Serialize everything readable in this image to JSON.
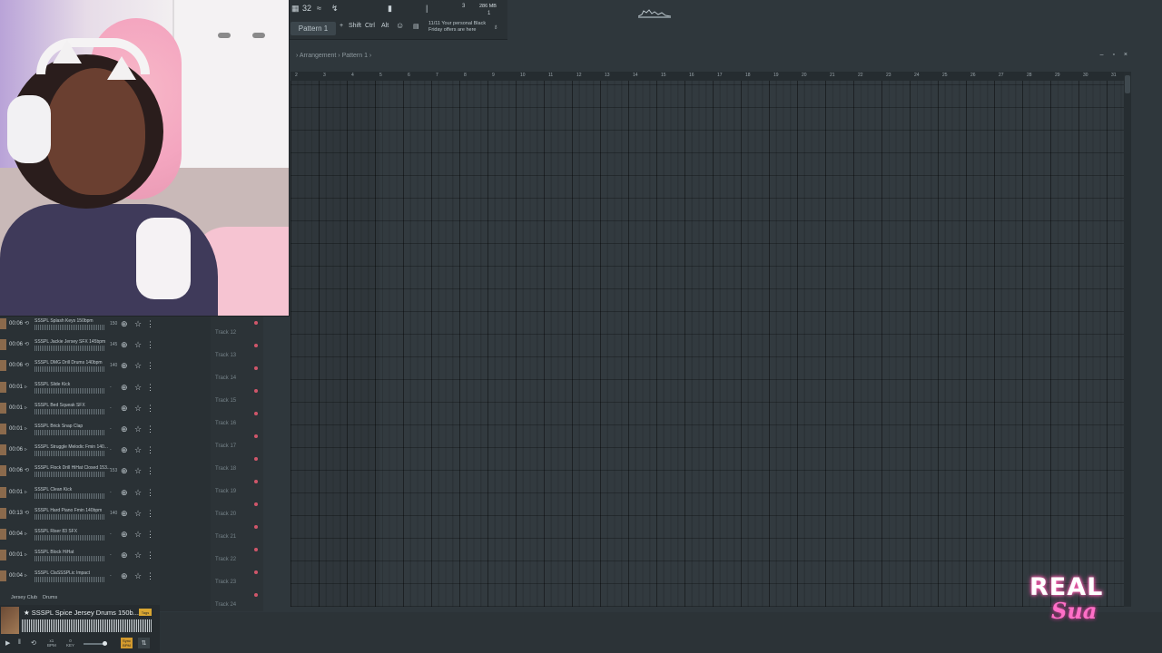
{
  "toolbar": {
    "tb_items": [
      "32",
      "≈",
      "↯"
    ],
    "pattern_label": "Pattern 1",
    "keys": [
      "Shift",
      "Ctrl",
      "Alt"
    ],
    "news_line1": "11/11  Your personal Black",
    "news_line2": "Friday offers are here",
    "mem_label": "286 MB",
    "counter1": "3",
    "counter2": "1"
  },
  "playlist": {
    "breadcrumb": "› Arrangement › Pattern 1 ›",
    "window_buttons": "– ▫ ×",
    "ruler": [
      "2",
      "3",
      "4",
      "5",
      "6",
      "7",
      "8",
      "9",
      "10",
      "11",
      "12",
      "13",
      "14",
      "15",
      "16",
      "17",
      "18",
      "19",
      "20",
      "21",
      "22",
      "23",
      "24",
      "25",
      "26",
      "27",
      "28",
      "29",
      "30",
      "31"
    ]
  },
  "tracks": [
    "Track 12",
    "Track 13",
    "Track 14",
    "Track 15",
    "Track 16",
    "Track 17",
    "Track 18",
    "Track 19",
    "Track 20",
    "Track 21",
    "Track 22",
    "Track 23",
    "Track 24"
  ],
  "browser": {
    "rows": [
      {
        "time": "00:06",
        "mode": "⟲",
        "name": "SSSPL Splash Keys 150bpm",
        "bpm": "150"
      },
      {
        "time": "00:06",
        "mode": "⟲",
        "name": "SSSPL Jackie Jersey SFX 145bpm",
        "bpm": "145"
      },
      {
        "time": "00:06",
        "mode": "⟲",
        "name": "SSSPL DMG Drill Drums 140bpm",
        "bpm": "140"
      },
      {
        "time": "00:01",
        "mode": "▹",
        "name": "SSSPL Slide Kick",
        "bpm": "-"
      },
      {
        "time": "00:01",
        "mode": "▹",
        "name": "SSSPL Bed Squeak SFX",
        "bpm": "-"
      },
      {
        "time": "00:01",
        "mode": "▹",
        "name": "SSSPL Brick Snap Clap",
        "bpm": "-"
      },
      {
        "time": "00:06",
        "mode": "▹",
        "name": "SSSPL Struggle Melodic Fmin 140...",
        "bpm": "-"
      },
      {
        "time": "00:06",
        "mode": "⟲",
        "name": "SSSPL Flock Drill HiHat Closed 153...",
        "bpm": "153"
      },
      {
        "time": "00:01",
        "mode": "▹",
        "name": "SSSPL Clean Kick",
        "bpm": "-"
      },
      {
        "time": "00:13",
        "mode": "⟲",
        "name": "SSSPL Hard Piano Fmin 140bpm",
        "bpm": "140"
      },
      {
        "time": "00:04",
        "mode": "▹",
        "name": "SSSPL Riser 83 SFX",
        "bpm": "-"
      },
      {
        "time": "00:01",
        "mode": "▹",
        "name": "SSSPL Block HiHat",
        "bpm": "-"
      },
      {
        "time": "00:04",
        "mode": "▹",
        "name": "SSSPL ClaSSSPLic Impact",
        "bpm": "-"
      }
    ],
    "tabs": [
      "Jersey Club",
      "Drums"
    ],
    "player": {
      "title": "★ SSSPL Spice Jersey Drums 150b...",
      "tag": "Tags",
      "x1": "x1",
      "x1_sub": "BPM",
      "key": "0",
      "key_sub": "KEY",
      "sync": "Sync BPM"
    }
  },
  "logo": {
    "line1": "REAL",
    "line2": "Sua"
  },
  "colors": {
    "accent_pink": "#ff6fc7",
    "track_dot": "#d0566a",
    "tag_gold": "#d9a632"
  }
}
